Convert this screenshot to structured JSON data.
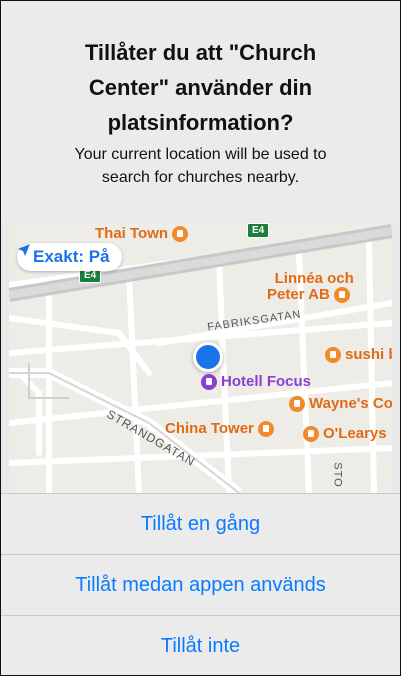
{
  "dialog": {
    "title_lines": [
      "Tillåter du att \"Church",
      "Center\" använder din",
      "platsinformation?"
    ],
    "message_lines": [
      "Your current location will be used to",
      "search for churches nearby."
    ]
  },
  "map": {
    "precise_badge": "Exakt: På",
    "pois": {
      "thai_town": "Thai Town",
      "linnea": [
        "Linnéa och",
        "Peter AB"
      ],
      "sushi": "sushi ba",
      "hotel": "Hotell Focus",
      "waynes": "Wayne's Coff",
      "china_tower": "China Tower",
      "olearys": "O'Learys"
    },
    "streets": {
      "fabriksgatan": "FABRIKSGATAN",
      "strandgatan": "STRANDGATAN",
      "sto": "STO"
    },
    "road_shields": [
      "E4",
      "E4"
    ],
    "colors": {
      "user_dot": "#1a73e8",
      "poi_orange": "#e06b17",
      "poi_purple": "#8a3fd1"
    }
  },
  "actions": [
    {
      "label": "Tillåt en gång"
    },
    {
      "label": "Tillåt medan appen används"
    },
    {
      "label": "Tillåt inte"
    }
  ]
}
